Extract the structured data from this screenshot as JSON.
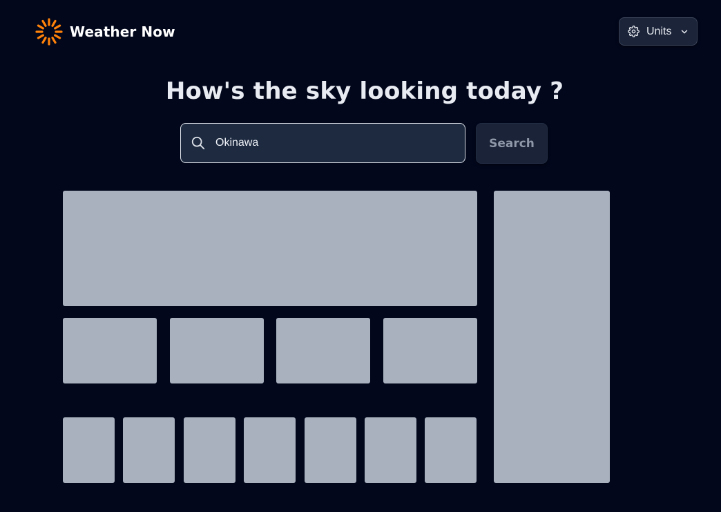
{
  "header": {
    "brand": {
      "title": "Weather Now",
      "icon": "sun-icon",
      "accent_color": "#ff820a"
    },
    "units_button": {
      "label": "Units",
      "icon": "gear-icon",
      "dropdown_icon": "chevron-down-icon"
    }
  },
  "hero": {
    "title": "How's the sky looking today ?"
  },
  "search": {
    "input_value": "Okinawa",
    "icon": "search-icon",
    "button_label": "Search"
  },
  "loading_placeholders": {
    "state": "loading",
    "color": "#a8b1bd",
    "main_card_count": 1,
    "stat_card_count": 4,
    "daily_card_count": 7,
    "sidebar_card_count": 1
  },
  "colors": {
    "background": "#02071c",
    "surface": "#1d2a40",
    "text": "#e8ebf1"
  }
}
